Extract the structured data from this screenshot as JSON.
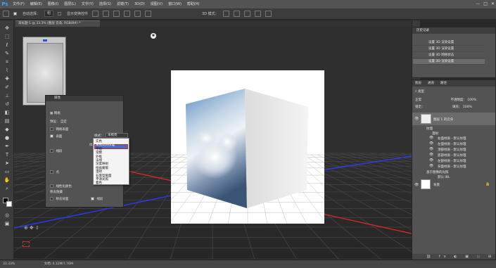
{
  "app": {
    "logo": "Ps"
  },
  "menu": [
    "文件(F)",
    "编辑(E)",
    "图像(I)",
    "图层(L)",
    "文字(Y)",
    "选择(S)",
    "滤镜(T)",
    "3D(D)",
    "视图(V)",
    "窗口(W)",
    "帮助(H)"
  ],
  "window_controls": [
    "—",
    "□",
    "✕"
  ],
  "options_bar": {
    "auto_select_label": "自动选择：",
    "auto_select_value": "组",
    "show_transform_label": "显示变换控件",
    "mode_3d_label": "3D 模式："
  },
  "document_tab": {
    "title": "未标题-1 @ 33.3% (图层 云朵, RGB/8#) *"
  },
  "properties": {
    "panel_title": "属性",
    "section_label": "3D",
    "mesh_label": "网格",
    "preset_label": "预设：",
    "preset_value": "自定",
    "diffuse_label": "网格表面",
    "surface_label": "表面",
    "style_label": "样式：",
    "style_value": "未照亮",
    "texture_label": "纹理：",
    "lines_label": "线段",
    "points_label": "点",
    "shadow_label": "移去隐藏",
    "remove_back_label": "移去背面",
    "line_opt": "线段",
    "catch_shadow": "捕捉阴影",
    "cast_shadow": "投影",
    "invisible": "不可见",
    "linearize": "线性化颜色"
  },
  "dropdown": {
    "items": [
      "实色",
      "未照亮的纹理",
      "平坦",
      "常数",
      "外框",
      "法线",
      "深度映射",
      "绘画蒙版",
      "漫射",
      "石膏型版面",
      "平滑光照",
      "着色"
    ],
    "selected_index": 1
  },
  "history": {
    "tabs": [
      "历史记录"
    ],
    "items": [
      "设置 3D 渲染设置",
      "设置 3D 渲染设置",
      "设置 3D 网格状态",
      "设置 3D 渲染设置"
    ],
    "selected_index": 3
  },
  "layers": {
    "tabs": [
      "图层",
      "通道",
      "路径"
    ],
    "filter_label": "类型",
    "blend_mode": "正常",
    "opacity_label": "不透明度：",
    "opacity_value": "100%",
    "lock_label": "锁定：",
    "fill_label": "填充：",
    "fill_value": "100%",
    "layer_3d_name": "图层 1 的云朵",
    "texture_group": "纹理",
    "diffuse_group": "漫射",
    "textures": [
      "右面材质 - 默认纹理",
      "左面材质 - 默认纹理",
      "顶部材质 - 默认纹理",
      "底部材质 - 默认纹理",
      "左部材质 - 默认纹理",
      "背面材质 - 默认纹理"
    ],
    "light_group": "基于图像的光照",
    "light_item": "默认 IBL",
    "bg_layer": "背景"
  },
  "status": {
    "zoom": "33.33%",
    "doc": "文档: 4.12M/7.76M"
  },
  "colors": {
    "ps_blue": "#31a8ff",
    "selected_item": "#3d6fc3",
    "highlight_border": "#d02020"
  }
}
